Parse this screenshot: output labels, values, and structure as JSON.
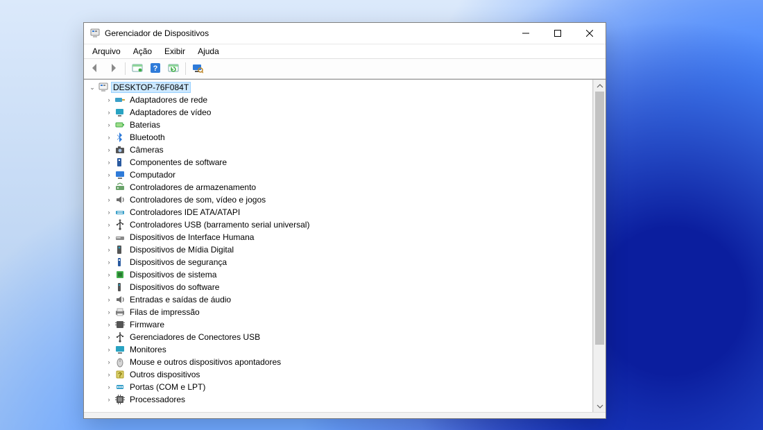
{
  "window": {
    "title": "Gerenciador de Dispositivos"
  },
  "menubar": {
    "items": [
      {
        "label": "Arquivo"
      },
      {
        "label": "Ação"
      },
      {
        "label": "Exibir"
      },
      {
        "label": "Ajuda"
      }
    ]
  },
  "toolbar": {
    "buttons": [
      {
        "name": "back-button",
        "icon": "arrow-left-icon"
      },
      {
        "name": "forward-button",
        "icon": "arrow-right-icon"
      },
      {
        "name": "sep"
      },
      {
        "name": "show-hidden-button",
        "icon": "panel-green-icon"
      },
      {
        "name": "help-button",
        "icon": "help-icon"
      },
      {
        "name": "refresh-button",
        "icon": "panel-refresh-icon"
      },
      {
        "name": "sep"
      },
      {
        "name": "scan-button",
        "icon": "monitor-scan-icon"
      }
    ]
  },
  "tree": {
    "root": {
      "label": "DESKTOP-76F084T",
      "icon": "computer-icon",
      "expanded": true,
      "selected": true
    },
    "categories": [
      {
        "label": "Adaptadores de rede",
        "icon": "network-adapter-icon"
      },
      {
        "label": "Adaptadores de vídeo",
        "icon": "display-adapter-icon"
      },
      {
        "label": "Baterias",
        "icon": "battery-icon"
      },
      {
        "label": "Bluetooth",
        "icon": "bluetooth-icon"
      },
      {
        "label": "Câmeras",
        "icon": "camera-icon"
      },
      {
        "label": "Componentes de software",
        "icon": "software-component-icon"
      },
      {
        "label": "Computador",
        "icon": "computer-category-icon"
      },
      {
        "label": "Controladores de armazenamento",
        "icon": "storage-controller-icon"
      },
      {
        "label": "Controladores de som, vídeo e jogos",
        "icon": "sound-controller-icon"
      },
      {
        "label": "Controladores IDE ATA/ATAPI",
        "icon": "ide-controller-icon"
      },
      {
        "label": "Controladores USB (barramento serial universal)",
        "icon": "usb-controller-icon"
      },
      {
        "label": "Dispositivos de Interface Humana",
        "icon": "hid-icon"
      },
      {
        "label": "Dispositivos de Mídia Digital",
        "icon": "digital-media-icon"
      },
      {
        "label": "Dispositivos de segurança",
        "icon": "security-device-icon"
      },
      {
        "label": "Dispositivos de sistema",
        "icon": "system-device-icon"
      },
      {
        "label": "Dispositivos do software",
        "icon": "software-device-icon"
      },
      {
        "label": "Entradas e saídas de áudio",
        "icon": "audio-io-icon"
      },
      {
        "label": "Filas de impressão",
        "icon": "print-queue-icon"
      },
      {
        "label": "Firmware",
        "icon": "firmware-icon"
      },
      {
        "label": "Gerenciadores de Conectores USB",
        "icon": "usb-connector-icon"
      },
      {
        "label": "Monitores",
        "icon": "monitor-icon"
      },
      {
        "label": "Mouse e outros dispositivos apontadores",
        "icon": "mouse-icon"
      },
      {
        "label": "Outros dispositivos",
        "icon": "other-device-icon"
      },
      {
        "label": "Portas (COM e LPT)",
        "icon": "port-icon"
      },
      {
        "label": "Processadores",
        "icon": "processor-icon"
      }
    ]
  }
}
